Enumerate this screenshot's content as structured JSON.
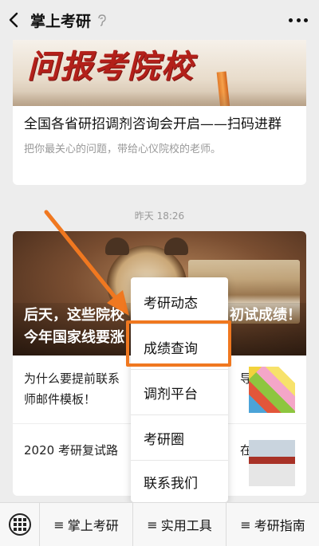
{
  "nav": {
    "title": "掌上考研"
  },
  "article1": {
    "banner_text": "问报考院校",
    "headline": "全国各省研招调剂咨询会开启——扫码进群",
    "desc": "把你最关心的问题，带给心仪院校的老师。"
  },
  "timestamp": "昨天 18:26",
  "article2": {
    "banner_title": "后天，这些院校",
    "banner_title_right": "初试成绩！",
    "banner_title_line2": "今年国家线要涨",
    "item1_title_left": "为什么要提前联系",
    "item1_title_right": "导",
    "item1_title_line2": "师邮件模板！",
    "item2_title_left": "2020 考研复试路",
    "item2_title_right": "在"
  },
  "menu": {
    "items": [
      "考研动态",
      "成绩查询",
      "调剂平台",
      "考研圈",
      "联系我们"
    ],
    "highlighted_index": 1,
    "highlight_color": "#f07820"
  },
  "bottom_bar": {
    "tabs": [
      {
        "icon": "≡",
        "label": "掌上考研"
      },
      {
        "icon": "≡",
        "label": "实用工具"
      },
      {
        "icon": "≡",
        "label": "考研指南"
      }
    ]
  }
}
